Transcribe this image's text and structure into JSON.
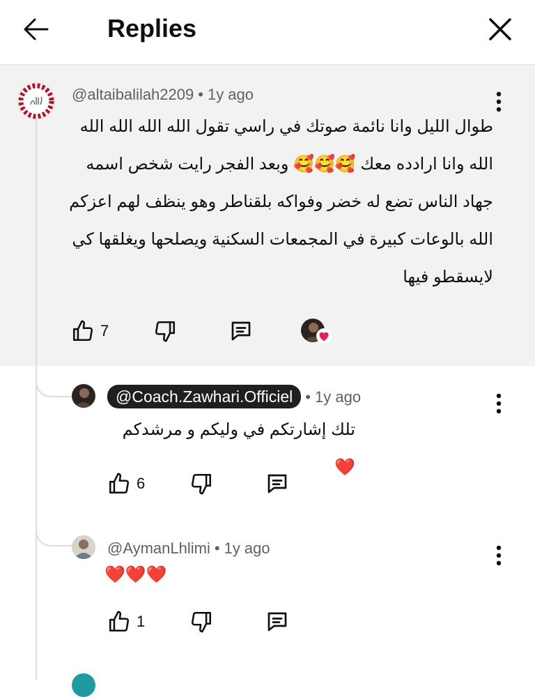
{
  "header": {
    "title": "Replies",
    "back_icon": "arrow-left-icon",
    "close_icon": "close-icon"
  },
  "colors": {
    "text": "#0f0f0f",
    "meta": "#606060",
    "parent_background": "#f2f2f2",
    "heart": "#e0245e",
    "badge_background": "#1f1f1f"
  },
  "parent_comment": {
    "author": "@altaibalilah2209",
    "time": "1y ago",
    "text": "طوال الليل وانا نائمة صوتك في راسي تقول الله الله الله الله الله وانا ارادده معك 🥰🥰🥰 وبعد الفجر رايت شخص اسمه جهاد الناس تضع له خضر وفواكه بلقناطر وهو ينظف لهم اعزكم الله بالوعات كبيرة في المجمعات السكنية ويصلحها ويغلقها كي لايسقطو فيها",
    "likes": "7",
    "creator_heart": true
  },
  "replies": [
    {
      "author": "@Coach.Zawhari.Officiel",
      "is_creator": true,
      "time": "1y ago",
      "text": "تلك إشارتكم في وليكم و مرشدكم❤️",
      "likes": "6"
    },
    {
      "author": "@AymanLhlimi",
      "is_creator": false,
      "time": "1y ago",
      "text": "❤️❤️❤️",
      "likes": "1"
    }
  ]
}
